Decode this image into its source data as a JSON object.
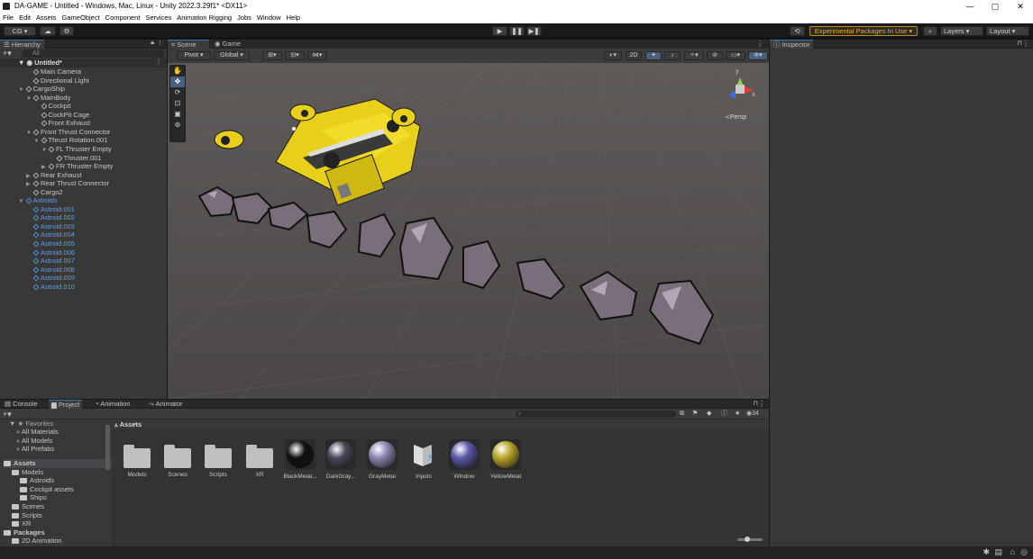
{
  "window": {
    "title": "DA-GAME - Untitled - Windows, Mac, Linux - Unity 2022.3.29f1* <DX11>",
    "minimize": "—",
    "maximize": "▢",
    "close": "✕"
  },
  "menu": [
    "File",
    "Edit",
    "Assets",
    "GameObject",
    "Component",
    "Services",
    "Animation Rigging",
    "Jobs",
    "Window",
    "Help"
  ],
  "toolbar": {
    "account": "CG ▾",
    "cloud": "☁",
    "gear": "⚙",
    "play": "▶",
    "pause": "❚❚",
    "step": "▶❚",
    "experimental": "Experimental Packages In Use ▾",
    "layers": "Layers",
    "layout": "Layout"
  },
  "hierarchy": {
    "tab": "Hierarchy",
    "search_placeholder": "All",
    "scene_name": "Untitled*",
    "items": [
      {
        "label": "Main Camera",
        "indent": 2,
        "arrow": ""
      },
      {
        "label": "Directional Light",
        "indent": 2,
        "arrow": ""
      },
      {
        "label": "CargoShip",
        "indent": 1,
        "arrow": "▼"
      },
      {
        "label": "MainBody",
        "indent": 2,
        "arrow": "▼"
      },
      {
        "label": "Cockpit",
        "indent": 3,
        "arrow": ""
      },
      {
        "label": "CockPit Cage",
        "indent": 3,
        "arrow": ""
      },
      {
        "label": "Front Exhaust",
        "indent": 3,
        "arrow": ""
      },
      {
        "label": "Front Thrust Connector",
        "indent": 2,
        "arrow": "▼"
      },
      {
        "label": "Thrust Rotation.001",
        "indent": 3,
        "arrow": "▼"
      },
      {
        "label": "FL Thruster Empty",
        "indent": 4,
        "arrow": "▼"
      },
      {
        "label": "Thruster.001",
        "indent": 5,
        "arrow": ""
      },
      {
        "label": "FR Thruster Empty",
        "indent": 4,
        "arrow": "▶"
      },
      {
        "label": "Rear Exhaust",
        "indent": 2,
        "arrow": "▶"
      },
      {
        "label": "Rear Thrust Connector",
        "indent": 2,
        "arrow": "▶"
      },
      {
        "label": "Cargo2",
        "indent": 2,
        "arrow": ""
      },
      {
        "label": "Astroids",
        "indent": 1,
        "arrow": "▼",
        "blue": true
      },
      {
        "label": "Astroid.001",
        "indent": 2,
        "arrow": "",
        "blue": true
      },
      {
        "label": "Astroid.002",
        "indent": 2,
        "arrow": "",
        "blue": true
      },
      {
        "label": "Astroid.003",
        "indent": 2,
        "arrow": "",
        "blue": true
      },
      {
        "label": "Astroid.004",
        "indent": 2,
        "arrow": "",
        "blue": true
      },
      {
        "label": "Astroid.005",
        "indent": 2,
        "arrow": "",
        "blue": true
      },
      {
        "label": "Astroid.006",
        "indent": 2,
        "arrow": "",
        "blue": true
      },
      {
        "label": "Astroid.007",
        "indent": 2,
        "arrow": "",
        "blue": true
      },
      {
        "label": "Astroid.008",
        "indent": 2,
        "arrow": "",
        "blue": true
      },
      {
        "label": "Astroid.009",
        "indent": 2,
        "arrow": "",
        "blue": true
      },
      {
        "label": "Astroid.010",
        "indent": 2,
        "arrow": "",
        "blue": true
      }
    ]
  },
  "scene": {
    "tabs": [
      "Scene",
      "Game"
    ],
    "pivot": "Pivot ▾",
    "global": "Global ▾",
    "mode_2d": "2D",
    "persp": "≺Persp",
    "gizmo_y": "y",
    "gizmo_x": "x"
  },
  "inspector": {
    "tab": "Inspector"
  },
  "bottom": {
    "tabs": [
      "Console",
      "Project",
      "Animation",
      "Animator"
    ],
    "search_count": "34",
    "favorites": [
      "Favorites",
      "All Materials",
      "All Models",
      "All Prefabs"
    ],
    "tree": [
      {
        "label": "Assets",
        "indent": 0,
        "bold": true
      },
      {
        "label": "Models",
        "indent": 1
      },
      {
        "label": "Astroids",
        "indent": 2
      },
      {
        "label": "Cockpit assets",
        "indent": 2
      },
      {
        "label": "Ships",
        "indent": 2
      },
      {
        "label": "Scenes",
        "indent": 1
      },
      {
        "label": "Scripts",
        "indent": 1
      },
      {
        "label": "XR",
        "indent": 1
      },
      {
        "label": "Packages",
        "indent": 0,
        "bold": true
      },
      {
        "label": "2D Animation",
        "indent": 1
      }
    ],
    "breadcrumb": "Assets",
    "assets": [
      {
        "label": "Models",
        "kind": "folder"
      },
      {
        "label": "Scenes",
        "kind": "folder"
      },
      {
        "label": "Scripts",
        "kind": "folder"
      },
      {
        "label": "XR",
        "kind": "folder"
      },
      {
        "label": "BlackMetal...",
        "kind": "material",
        "color": "#111111"
      },
      {
        "label": "DarkGray...",
        "kind": "material",
        "color": "#4a4658"
      },
      {
        "label": "GrayMetal",
        "kind": "material",
        "color": "#8a86b0"
      },
      {
        "label": "Inputs",
        "kind": "input"
      },
      {
        "label": "Window",
        "kind": "material",
        "color": "#5a5aa8"
      },
      {
        "label": "YellowMetal",
        "kind": "material",
        "color": "#b8a628"
      }
    ]
  }
}
